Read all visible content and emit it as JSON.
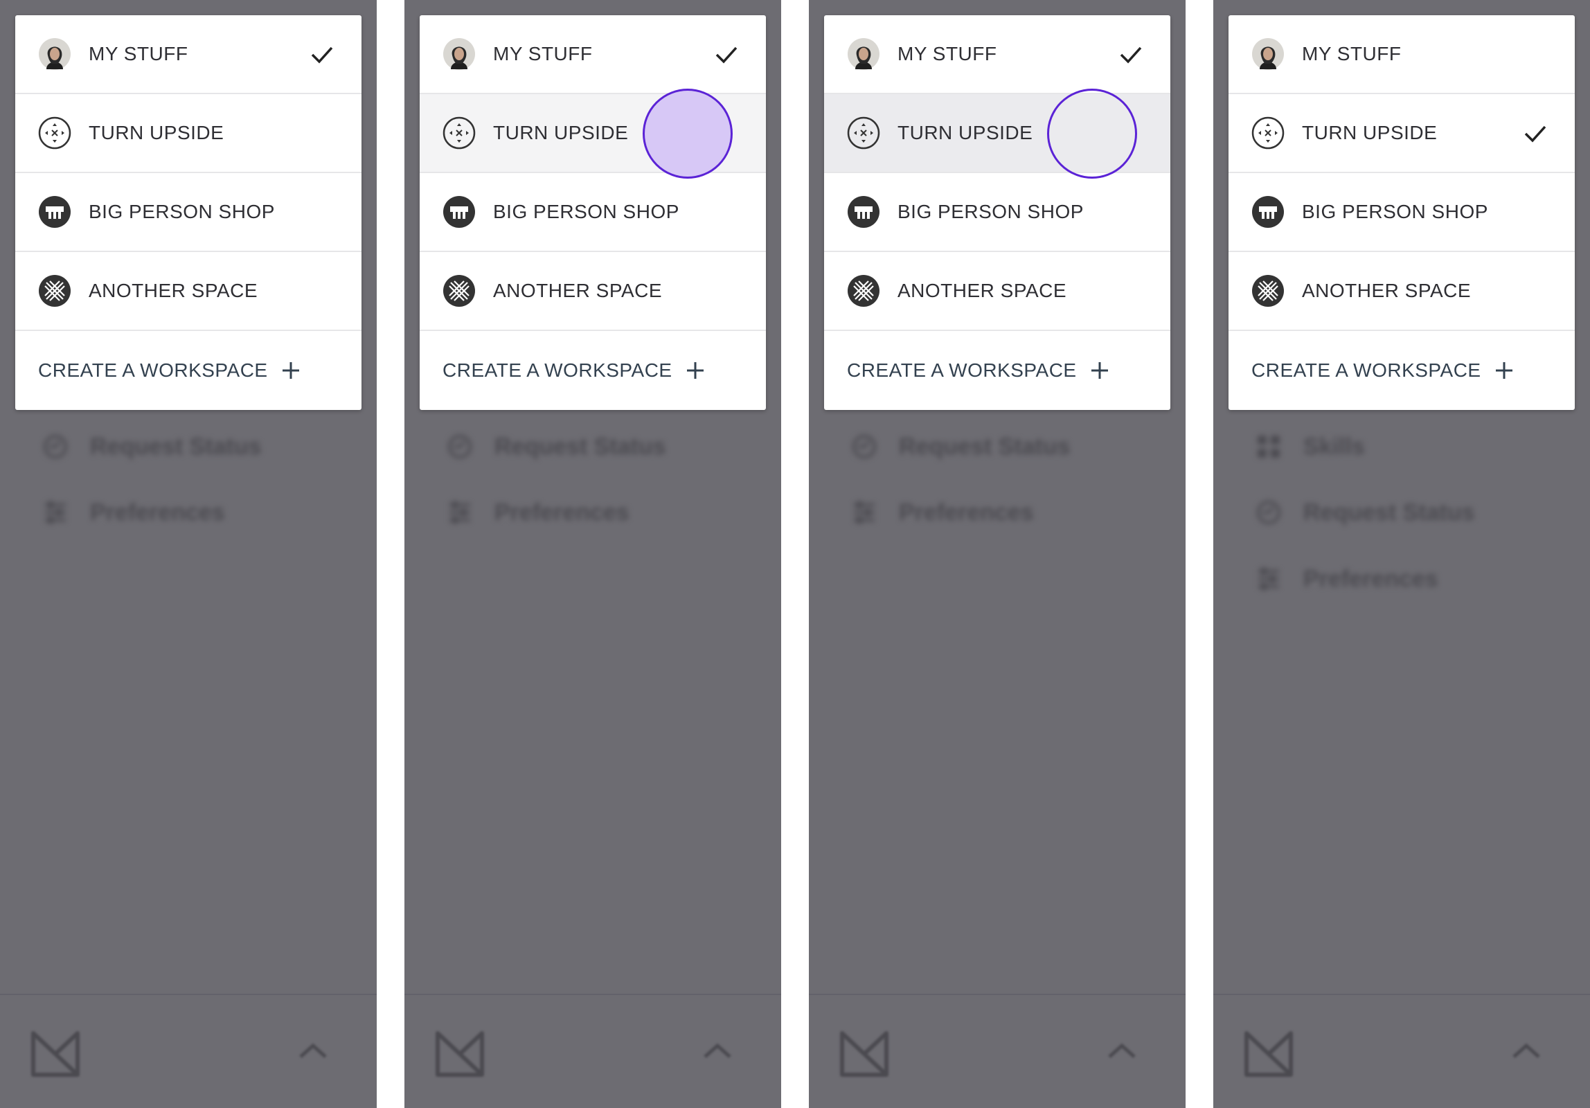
{
  "menu": {
    "items": [
      {
        "label": "MY STUFF",
        "icon": "avatar"
      },
      {
        "label": "TURN UPSIDE",
        "icon": "turn-upside-icon"
      },
      {
        "label": "BIG PERSON SHOP",
        "icon": "big-person-shop-icon"
      },
      {
        "label": "ANOTHER SPACE",
        "icon": "another-space-icon"
      }
    ],
    "create_label": "CREATE A WORKSPACE"
  },
  "nav": {
    "skills": "Skills",
    "request_status": "Request Status",
    "preferences": "Preferences"
  },
  "colors": {
    "overlay": "#6d6c72",
    "touch_ring": "#5b23d6",
    "touch_fill": "#d7c8f6",
    "text": "#2e2e33",
    "create_text": "#33414f"
  }
}
